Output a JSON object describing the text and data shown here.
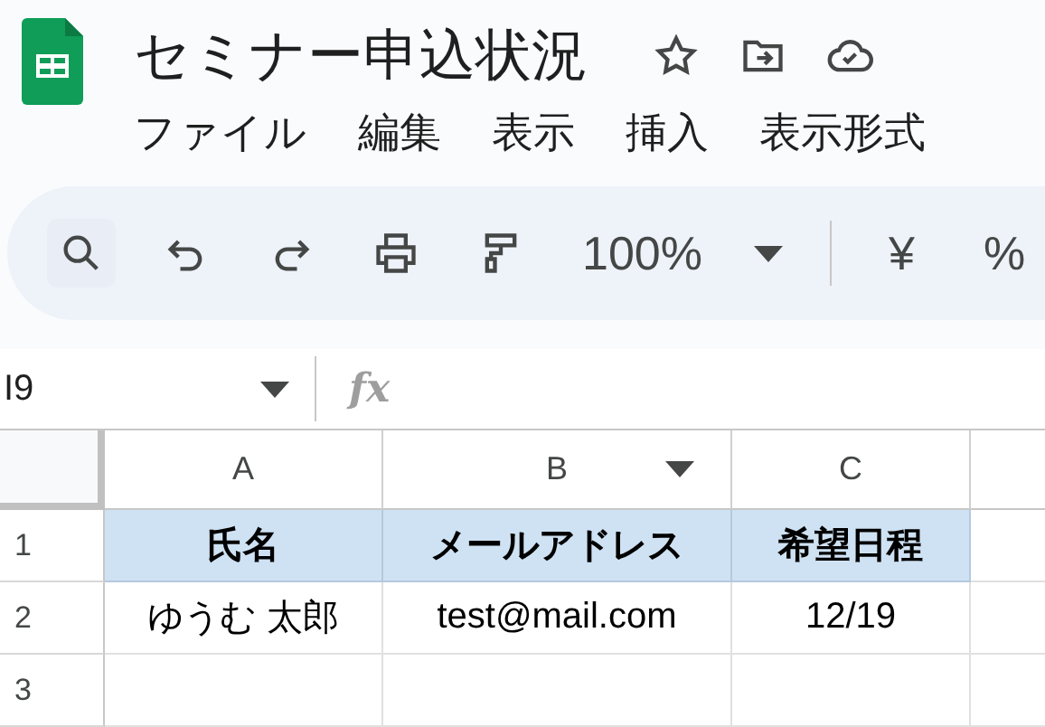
{
  "document": {
    "title": "セミナー申込状況"
  },
  "menu": [
    "ファイル",
    "編集",
    "表示",
    "挿入",
    "表示形式"
  ],
  "toolbar": {
    "zoom": "100%",
    "currency": "¥",
    "percent": "%"
  },
  "formula_bar": {
    "cell_reference": "I9",
    "fx_label": "fx"
  },
  "sheet": {
    "columns": [
      {
        "label": "A",
        "menu": false
      },
      {
        "label": "B",
        "menu": true
      },
      {
        "label": "C",
        "menu": false
      }
    ],
    "rows": [
      {
        "number": "1",
        "kind": "header",
        "cells": [
          "氏名",
          "メールアドレス",
          "希望日程"
        ]
      },
      {
        "number": "2",
        "kind": "data",
        "cells": [
          "ゆうむ 太郎",
          "test@mail.com",
          "12/19"
        ]
      },
      {
        "number": "3",
        "kind": "data",
        "cells": [
          "",
          "",
          ""
        ]
      }
    ]
  }
}
